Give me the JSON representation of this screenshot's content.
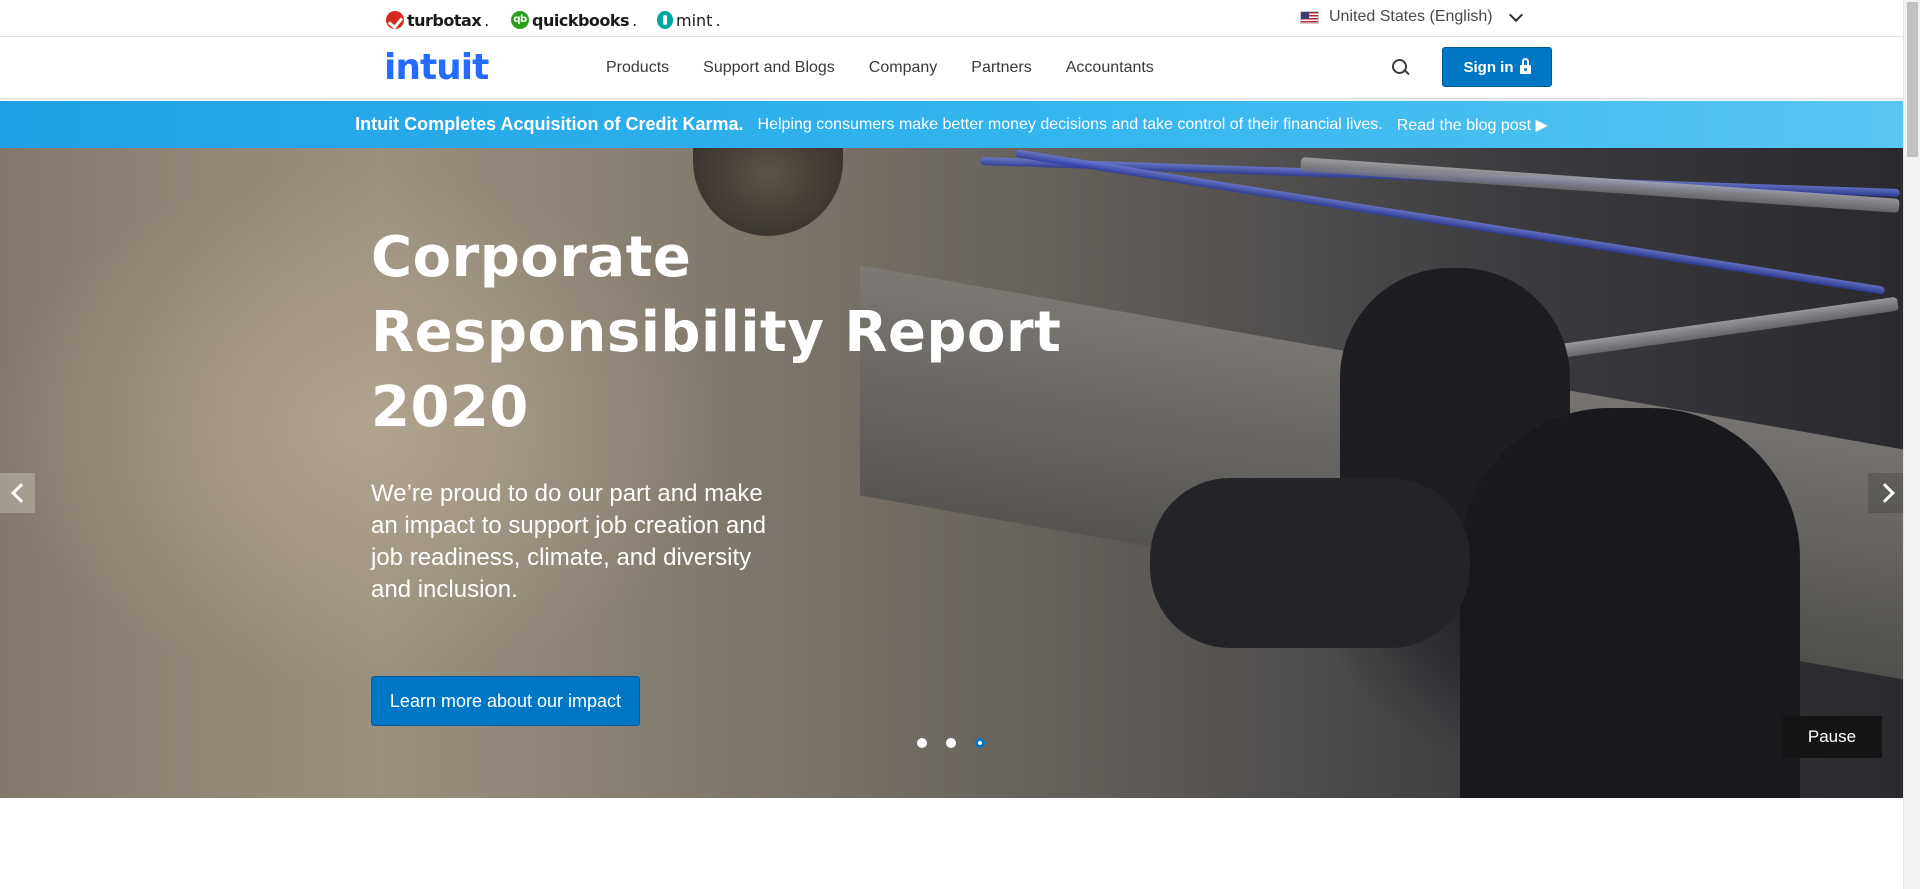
{
  "brands": {
    "turbotax": "turbotax",
    "quickbooks": "quickbooks",
    "quickbooks_mark": "qb",
    "mint": "mint"
  },
  "locale": {
    "label": "United States (English)"
  },
  "nav": {
    "logo": "intuit",
    "items": [
      "Products",
      "Support and Blogs",
      "Company",
      "Partners",
      "Accountants"
    ],
    "signin_label": "Sign in"
  },
  "announcement": {
    "headline": "Intuit Completes Acquisition of Credit Karma.",
    "body": "Helping consumers make better money decisions and take control of their financial lives.",
    "link": "Read the blog post ▶"
  },
  "hero": {
    "title": "Corporate Responsibility Report 2020",
    "subtitle": "We’re proud to do our part and make an impact to support job creation and job readiness, climate, and diversity and inclusion.",
    "cta_label": "Learn more about our impact",
    "pause_label": "Pause",
    "carousel_total": 3,
    "carousel_active": 3
  },
  "colors": {
    "primary": "#0077c5",
    "announce_bar": "#1fa0e6",
    "logo": "#236cff"
  },
  "icons": [
    "turbotax-icon",
    "quickbooks-icon",
    "mint-icon",
    "us-flag-icon",
    "chevron-down-icon",
    "search-icon",
    "lock-icon",
    "chevron-left-icon",
    "chevron-right-icon"
  ]
}
